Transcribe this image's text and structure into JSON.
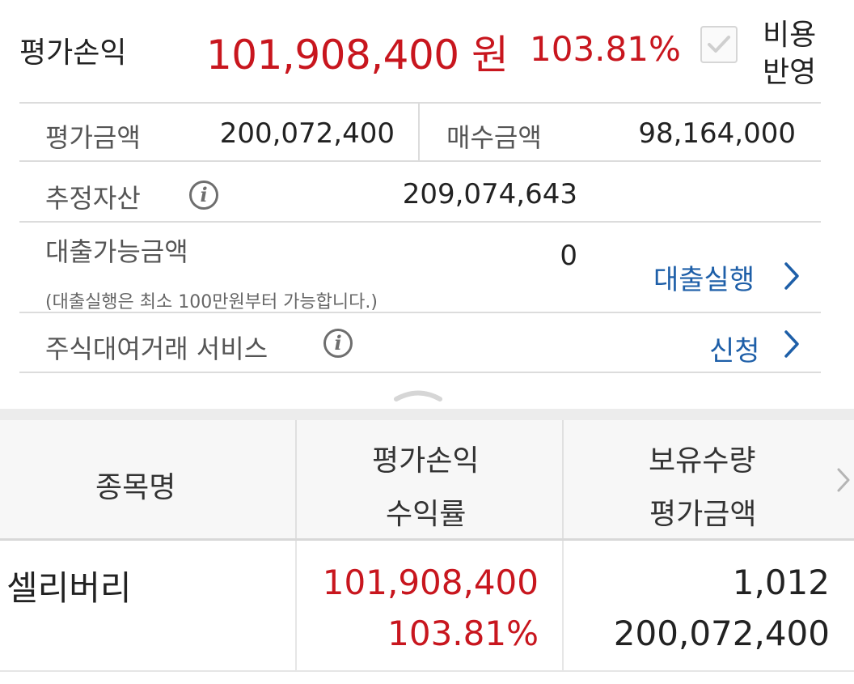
{
  "summary": {
    "pl_label": "평가손익",
    "pl_amount": "101,908,400 원",
    "pl_rate": "103.81%",
    "fee_label_line1": "비용",
    "fee_label_line2": "반영",
    "fee_checked": true
  },
  "details": {
    "eval_amount_label": "평가금액",
    "eval_amount_value": "200,072,400",
    "buy_amount_label": "매수금액",
    "buy_amount_value": "98,164,000",
    "est_assets_label": "추정자산",
    "est_assets_value": "209,074,643",
    "loan_available_label": "대출가능금액",
    "loan_available_value": "0",
    "loan_note": "(대출실행은 최소 100만원부터 가능합니다.)",
    "loan_exec_link": "대출실행",
    "stock_lending_label": "주식대여거래 서비스",
    "stock_lending_link": "신청"
  },
  "table": {
    "headers": {
      "name": "종목명",
      "pl_line1": "평가손익",
      "pl_line2": "수익률",
      "qty_line1": "보유수량",
      "qty_line2": "평가금액"
    },
    "rows": [
      {
        "name": "셀리버리",
        "pl": "101,908,400",
        "rate": "103.81%",
        "qty": "1,012",
        "eval": "200,072,400"
      }
    ]
  },
  "colors": {
    "profit_red": "#c8161e",
    "link_blue": "#1e5fa8"
  }
}
